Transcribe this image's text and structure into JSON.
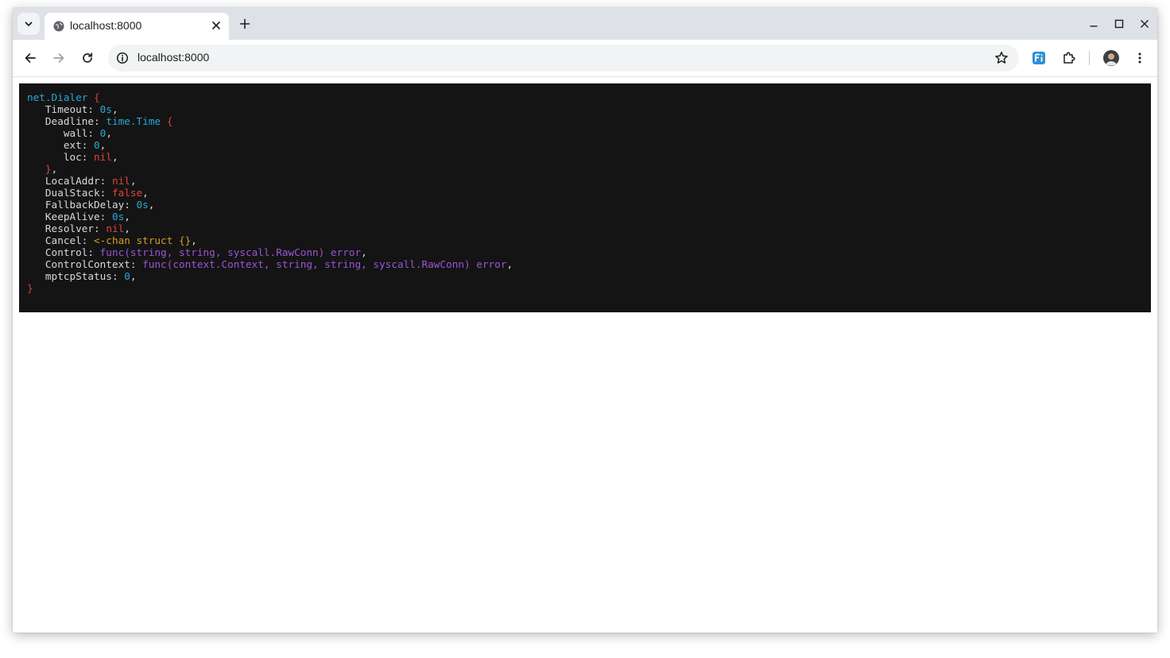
{
  "browser": {
    "tab_title": "localhost:8000",
    "url": "localhost:8000"
  },
  "code": {
    "lines": [
      [
        {
          "t": "net.Dialer ",
          "c": "type"
        },
        {
          "t": "{",
          "c": "brace"
        }
      ],
      [
        {
          "t": "   Timeout: ",
          "c": "plain"
        },
        {
          "t": "0s",
          "c": "num"
        },
        {
          "t": ",",
          "c": "plain"
        }
      ],
      [
        {
          "t": "   Deadline: ",
          "c": "plain"
        },
        {
          "t": "time.Time ",
          "c": "type"
        },
        {
          "t": "{",
          "c": "brace"
        }
      ],
      [
        {
          "t": "      wall: ",
          "c": "plain"
        },
        {
          "t": "0",
          "c": "num"
        },
        {
          "t": ",",
          "c": "plain"
        }
      ],
      [
        {
          "t": "      ext: ",
          "c": "plain"
        },
        {
          "t": "0",
          "c": "num"
        },
        {
          "t": ",",
          "c": "plain"
        }
      ],
      [
        {
          "t": "      loc: ",
          "c": "plain"
        },
        {
          "t": "nil",
          "c": "nil"
        },
        {
          "t": ",",
          "c": "plain"
        }
      ],
      [
        {
          "t": "   }",
          "c": "brace"
        },
        {
          "t": ",",
          "c": "plain"
        }
      ],
      [
        {
          "t": "   LocalAddr: ",
          "c": "plain"
        },
        {
          "t": "nil",
          "c": "nil"
        },
        {
          "t": ",",
          "c": "plain"
        }
      ],
      [
        {
          "t": "   DualStack: ",
          "c": "plain"
        },
        {
          "t": "false",
          "c": "nil"
        },
        {
          "t": ",",
          "c": "plain"
        }
      ],
      [
        {
          "t": "   FallbackDelay: ",
          "c": "plain"
        },
        {
          "t": "0s",
          "c": "num"
        },
        {
          "t": ",",
          "c": "plain"
        }
      ],
      [
        {
          "t": "   KeepAlive: ",
          "c": "plain"
        },
        {
          "t": "0s",
          "c": "num"
        },
        {
          "t": ",",
          "c": "plain"
        }
      ],
      [
        {
          "t": "   Resolver: ",
          "c": "plain"
        },
        {
          "t": "nil",
          "c": "nil"
        },
        {
          "t": ",",
          "c": "plain"
        }
      ],
      [
        {
          "t": "   Cancel: ",
          "c": "plain"
        },
        {
          "t": "<-chan struct {}",
          "c": "chan"
        },
        {
          "t": ",",
          "c": "plain"
        }
      ],
      [
        {
          "t": "   Control: ",
          "c": "plain"
        },
        {
          "t": "func(string, string, syscall.RawConn) error",
          "c": "func"
        },
        {
          "t": ",",
          "c": "plain"
        }
      ],
      [
        {
          "t": "   ControlContext: ",
          "c": "plain"
        },
        {
          "t": "func(context.Context, string, string, syscall.RawConn) error",
          "c": "func"
        },
        {
          "t": ",",
          "c": "plain"
        }
      ],
      [
        {
          "t": "   mptcpStatus: ",
          "c": "plain"
        },
        {
          "t": "0",
          "c": "num"
        },
        {
          "t": ",",
          "c": "plain"
        }
      ],
      [
        {
          "t": "}",
          "c": "brace"
        }
      ]
    ]
  },
  "colors": {
    "type": "#2aa7d6",
    "brace": "#c94a3a",
    "nil": "#e0433a",
    "chan": "#d89a2a",
    "func": "#9b55d6",
    "background": "#141414"
  }
}
